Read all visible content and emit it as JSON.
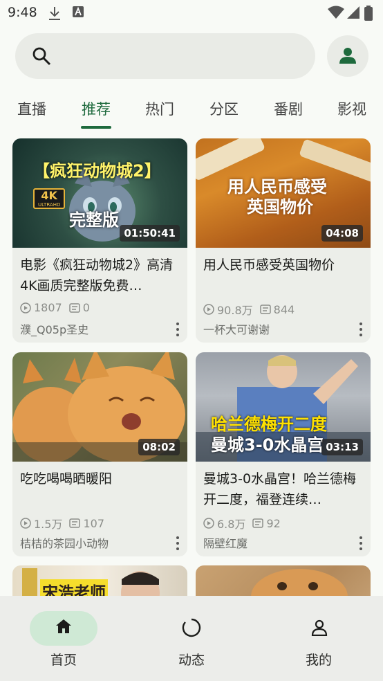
{
  "status_bar": {
    "time": "9:48"
  },
  "search": {
    "placeholder": ""
  },
  "tabs": [
    {
      "label": "直播"
    },
    {
      "label": "推荐",
      "active": true
    },
    {
      "label": "热门"
    },
    {
      "label": "分区"
    },
    {
      "label": "番剧"
    },
    {
      "label": "影视"
    }
  ],
  "cards": [
    {
      "thumb_text": [
        "【疯狂动物城2】",
        "4K",
        "ULTRAHD",
        "完整版"
      ],
      "duration": "01:50:41",
      "title": "电影《疯狂动物城2》高清4K画质完整版免费…",
      "views": "1807",
      "comments": "0",
      "author": "濮_Q05p圣史"
    },
    {
      "thumb_text": [
        "用人民币感受",
        "英国物价"
      ],
      "duration": "04:08",
      "title": "用人民币感受英国物价",
      "views": "90.8万",
      "comments": "844",
      "author": "一杯大可谢谢"
    },
    {
      "thumb_text": [],
      "duration": "08:02",
      "title": "吃吃喝喝晒暖阳",
      "views": "1.5万",
      "comments": "107",
      "author": "桔桔的茶园小动物"
    },
    {
      "thumb_text": [
        "哈兰德梅开二度",
        "曼城3-0水晶宫"
      ],
      "duration": "03:13",
      "title": "曼城3-0水晶宫！哈兰德梅开二度，福登连续…",
      "views": "6.8万",
      "comments": "92",
      "author": "隔壁红魔"
    },
    {
      "thumb_text": [
        "宋浩老师"
      ]
    },
    {
      "thumb_text": []
    }
  ],
  "bottom_nav": [
    {
      "label": "首页",
      "icon": "home-icon",
      "active": true
    },
    {
      "label": "动态",
      "icon": "activity-icon"
    },
    {
      "label": "我的",
      "icon": "profile-icon"
    }
  ],
  "colors": {
    "accent": "#1e6a3d",
    "pill": "#cfe9d5",
    "card": "#eceee9"
  }
}
